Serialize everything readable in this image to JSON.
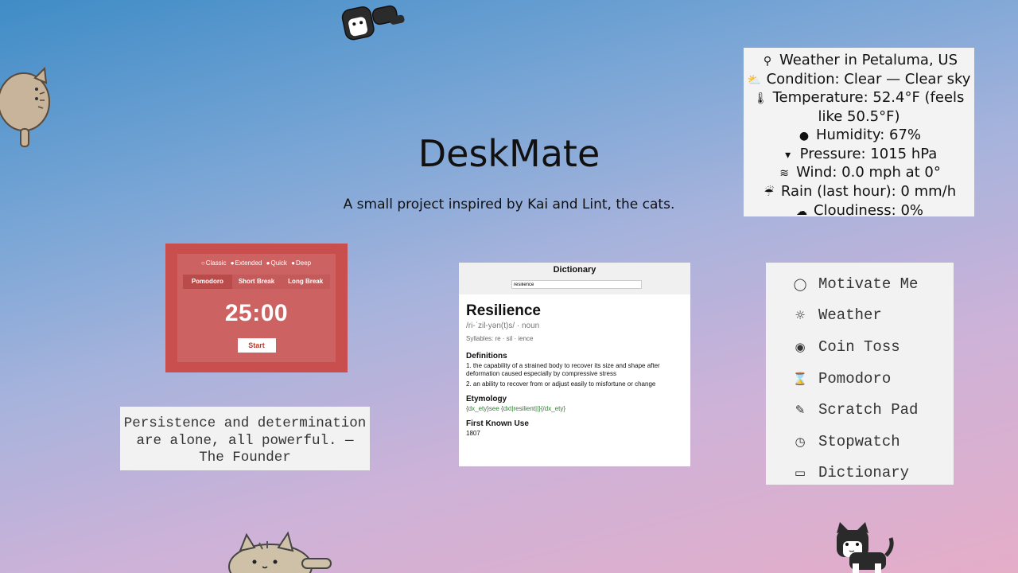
{
  "header": {
    "title": "DeskMate",
    "subtitle": "A small project inspired by Kai and Lint, the cats."
  },
  "weather": {
    "location": "Weather in Petaluma, US",
    "condition": "Condition: Clear — Clear sky",
    "temperature": "Temperature: 52.4°F (feels like 50.5°F)",
    "humidity": "Humidity: 67%",
    "pressure": "Pressure: 1015 hPa",
    "wind": "Wind: 0.0 mph at 0°",
    "rain": "Rain (last hour): 0 mm/h",
    "cloudiness": "Cloudiness: 0%"
  },
  "pomodoro": {
    "modes": [
      "Classic",
      "Extended",
      "Quick",
      "Deep"
    ],
    "tabs": [
      "Pomodoro",
      "Short Break",
      "Long Break"
    ],
    "time": "25:00",
    "start_label": "Start"
  },
  "quote": {
    "text": "Persistence and determination are alone, all powerful. — The Founder"
  },
  "dictionary": {
    "title": "Dictionary",
    "search_value": "resilience",
    "word": "Resilience",
    "pronunciation": "/ri-ˈzil-yən(t)s/ · noun",
    "syllables": "Syllables: re · sil · ience",
    "definitions_heading": "Definitions",
    "definitions": [
      "1. the capability of a strained body to recover its size and shape after deformation caused especially by compressive stress",
      "2. an ability to recover from or adjust easily to misfortune or change"
    ],
    "etymology_heading": "Etymology",
    "etymology": "{dx_ety}see {dxt|resilient||}{/dx_ety}",
    "first_use_heading": "First Known Use",
    "first_use": "1807"
  },
  "menu": {
    "items": [
      {
        "label": "Motivate Me",
        "icon": "speech-bubble-icon"
      },
      {
        "label": "Weather",
        "icon": "sun-cloud-icon"
      },
      {
        "label": "Coin Toss",
        "icon": "coin-icon"
      },
      {
        "label": "Pomodoro",
        "icon": "hourglass-icon"
      },
      {
        "label": "Scratch Pad",
        "icon": "edit-note-icon"
      },
      {
        "label": "Stopwatch",
        "icon": "clock-icon"
      },
      {
        "label": "Dictionary",
        "icon": "book-icon"
      }
    ]
  },
  "colors": {
    "pomodoro_bg": "#c94f4f",
    "etymology_text": "#2e7d32"
  }
}
